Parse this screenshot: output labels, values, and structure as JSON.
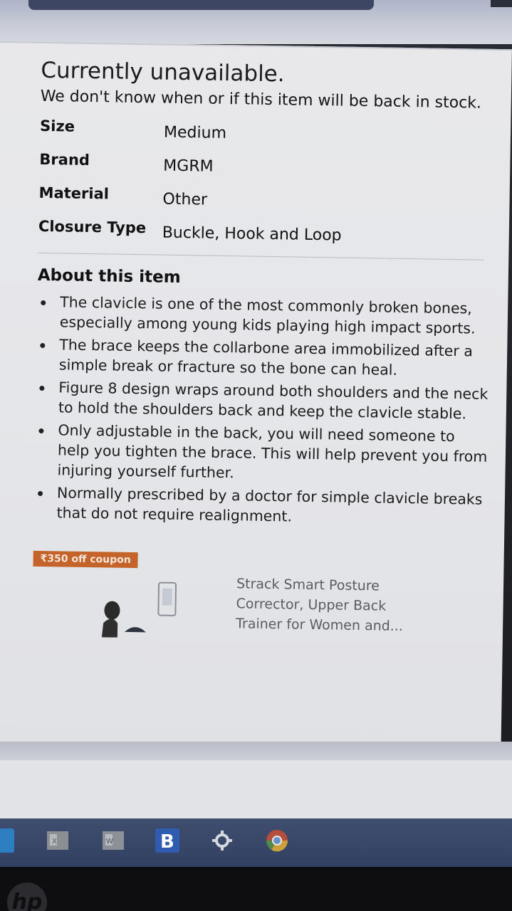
{
  "availability": {
    "title": "Currently unavailable.",
    "message": "We don't know when or if this item will be back in stock."
  },
  "specs": [
    {
      "key": "Size",
      "value": "Medium"
    },
    {
      "key": "Brand",
      "value": "MGRM"
    },
    {
      "key": "Material",
      "value": "Other"
    },
    {
      "key": "Closure Type",
      "value": "Buckle, Hook and Loop"
    }
  ],
  "about": {
    "heading": "About this item",
    "bullets": [
      "The clavicle is one of the most commonly broken bones, especially among young kids playing high impact sports.",
      "The brace keeps the collarbone area immobilized after a simple break or fracture so the bone can heal.",
      "Figure 8 design wraps around both shoulders and the neck to hold the shoulders back and keep the clavicle stable.",
      "Only adjustable in the back, you will need someone to help you tighten the brace. This will help prevent you from injuring yourself further.",
      "Normally prescribed by a doctor for simple clavicle breaks that do not require realignment."
    ]
  },
  "sponsored": {
    "coupon": "₹350 off coupon",
    "product_title": "Strack Smart Posture Corrector, Upper Back Trainer for Women and..."
  },
  "taskbar": {
    "icons": [
      "excel-icon",
      "word-icon",
      "b-app-icon",
      "settings-icon",
      "chrome-icon"
    ]
  },
  "device": {
    "logo": "hp"
  }
}
